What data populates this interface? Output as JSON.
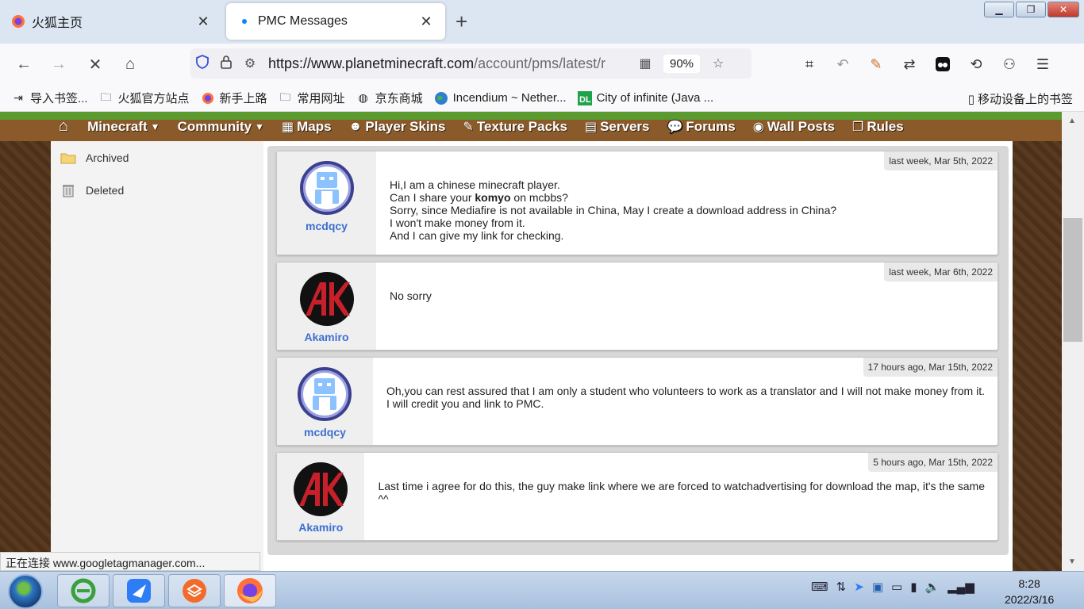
{
  "browser": {
    "tabs": [
      {
        "title": "火狐主页",
        "active": false
      },
      {
        "title": "PMC Messages",
        "active": true
      }
    ],
    "new_tab_label": "+",
    "url_display": {
      "host": "https://www.planetminecraft.com",
      "path": "/account/pms/latest/r"
    },
    "zoom": "90%",
    "bookmarks": [
      {
        "label": "导入书签...",
        "icon": "import-icon"
      },
      {
        "label": "火狐官方站点",
        "icon": "folder-icon"
      },
      {
        "label": "新手上路",
        "icon": "firefox-icon"
      },
      {
        "label": "常用网址",
        "icon": "folder-icon"
      },
      {
        "label": "京东商城",
        "icon": "globe-icon"
      },
      {
        "label": "Incendium ~ Nether...",
        "icon": "earth-icon"
      },
      {
        "label": "City of infinite (Java ...",
        "icon": "dl-icon"
      }
    ],
    "mobile_bookmarks": "移动设备上的书签"
  },
  "site_nav": {
    "items": [
      {
        "label": "Minecraft",
        "dropdown": true
      },
      {
        "label": "Community",
        "dropdown": true
      },
      {
        "label": "Maps",
        "icon": "map-icon"
      },
      {
        "label": "Player Skins",
        "icon": "skin-icon"
      },
      {
        "label": "Texture Packs",
        "icon": "brush-icon"
      },
      {
        "label": "Servers",
        "icon": "server-icon"
      },
      {
        "label": "Forums",
        "icon": "forum-icon"
      },
      {
        "label": "Wall Posts",
        "icon": "wall-icon"
      },
      {
        "label": "Rules",
        "icon": "book-icon"
      }
    ]
  },
  "folders": [
    {
      "label": "Archived",
      "icon": "folder-icon"
    },
    {
      "label": "Deleted",
      "icon": "trash-icon"
    }
  ],
  "messages": [
    {
      "author": "mcdqcy",
      "avatar": "robot",
      "date": "last week, Mar 5th, 2022",
      "lines": [
        "Hi,I am a chinese minecraft player.",
        "Can I share your ",
        "komyo",
        " on mcbbs?",
        "Sorry, since Mediafire is not available in China, May I create a download address in China?",
        "I won't make money from it.",
        "And I can give my link for checking."
      ]
    },
    {
      "author": "Akamiro",
      "avatar": "ak",
      "date": "last week, Mar 6th, 2022",
      "lines": [
        "No sorry"
      ]
    },
    {
      "author": "mcdqcy",
      "avatar": "robot",
      "date": "17 hours ago, Mar 15th, 2022",
      "lines": [
        "Oh,you can rest assured that I am only a student who volunteers to work as a translator and I will not make money from it.",
        "I will credit you and link to PMC."
      ]
    },
    {
      "author": "Akamiro",
      "avatar": "ak",
      "date": "5 hours ago, Mar 15th, 2022",
      "lines": [
        "Last time i agree for do this, the guy make link where we are forced to watchadvertising for download the map, it's the same",
        "^^"
      ]
    }
  ],
  "status_tip": "正在连接 www.googletagmanager.com...",
  "taskbar": {
    "time": "8:28",
    "date": "2022/3/16"
  }
}
